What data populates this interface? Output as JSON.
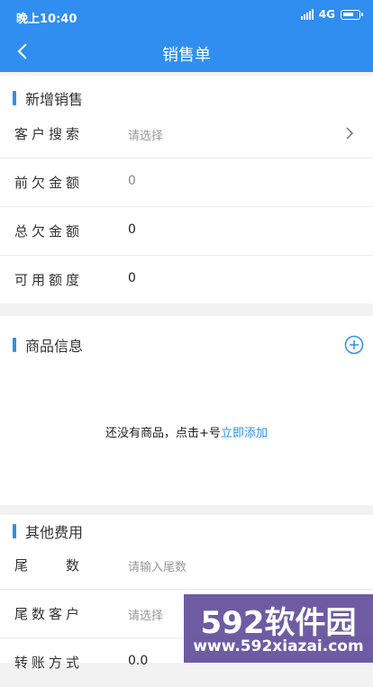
{
  "status": {
    "time": "晚上10:40",
    "network": "4G"
  },
  "nav": {
    "title": "销售单"
  },
  "sections": {
    "new_sale": {
      "title": "新增销售",
      "rows": [
        {
          "label": "客户搜索",
          "value": "请选择"
        },
        {
          "label": "前欠金额",
          "value": "0"
        },
        {
          "label": "总欠金额",
          "value": "0"
        },
        {
          "label": "可用额度",
          "value": "0"
        }
      ]
    },
    "goods": {
      "title": "商品信息",
      "empty_text": "还没有商品，点击+号",
      "add_link": "立即添加"
    },
    "other": {
      "title": "其他费用",
      "rows": [
        {
          "label": "尾　　数",
          "placeholder": "请输入尾数"
        },
        {
          "label": "尾数客户",
          "value": "请选择"
        },
        {
          "label": "转账方式",
          "value": "0.0"
        }
      ]
    }
  },
  "watermark": {
    "logo": "592软件园",
    "url": "www.592xiazai.com"
  },
  "colors": {
    "primary": "#2f8ef0"
  }
}
